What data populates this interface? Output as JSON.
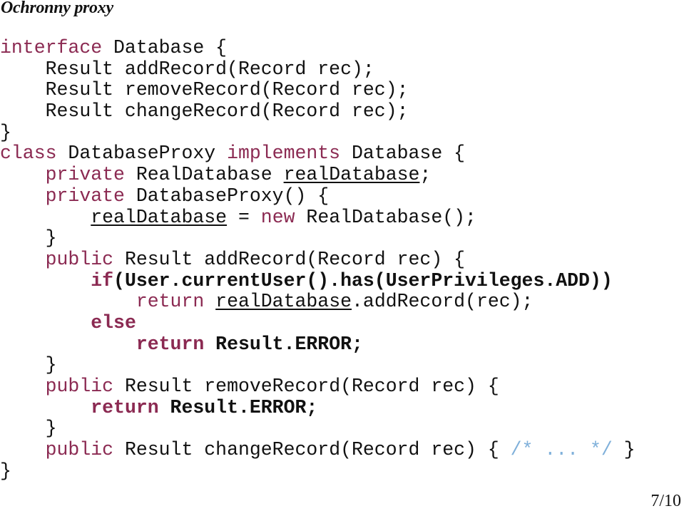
{
  "slide": {
    "title": "Ochronny proxy",
    "page_number": "7/10"
  },
  "colors": {
    "keyword": "#8b2a52",
    "comment": "#7fb0da",
    "text": "#111111"
  },
  "code": {
    "l1": {
      "kw": "interface",
      "rest": " Database {"
    },
    "l2": {
      "text": "    Result addRecord(Record rec);"
    },
    "l3": {
      "text": "    Result removeRecord(Record rec);"
    },
    "l4": {
      "text": "    Result changeRecord(Record rec);"
    },
    "l5": {
      "text": "}"
    },
    "l6": {
      "kw1": "class",
      "mid": " DatabaseProxy ",
      "kw2": "implements",
      "rest": " Database {"
    },
    "l7": {
      "indent": "    ",
      "kw": "private",
      "mid": " RealDatabase ",
      "field": "realDatabase",
      "rest": ";"
    },
    "l8": {
      "indent": "    ",
      "kw": "private",
      "rest": " DatabaseProxy() {"
    },
    "l9": {
      "indent": "        ",
      "field": "realDatabase",
      "mid": " = ",
      "kw": "new",
      "rest": " RealDatabase();"
    },
    "l10": {
      "text": "    }"
    },
    "l11": {
      "indent": "    ",
      "kw": "public",
      "rest": " Result addRecord(Record rec) {"
    },
    "l12": {
      "indent": "        ",
      "kw": "if",
      "rest": "(User.currentUser().has(UserPrivileges.ADD))"
    },
    "l13": {
      "indent": "            ",
      "kw": "return",
      "sp": " ",
      "field": "realDatabase",
      "rest": ".addRecord(rec);"
    },
    "l14": {
      "indent": "        ",
      "kw": "else"
    },
    "l15": {
      "indent": "            ",
      "kw": "return",
      "rest": " Result.ERROR;"
    },
    "l16": {
      "text": "    }"
    },
    "l17": {
      "indent": "    ",
      "kw": "public",
      "rest": " Result removeRecord(Record rec) {"
    },
    "l18": {
      "indent": "        ",
      "kw": "return",
      "rest": " Result.ERROR;"
    },
    "l19": {
      "text": "    }"
    },
    "l20": {
      "indent": "    ",
      "kw": "public",
      "mid": " Result changeRecord(Record rec) { ",
      "comment": "/* ... */",
      "rest": " }"
    },
    "l21": {
      "text": "}"
    }
  }
}
